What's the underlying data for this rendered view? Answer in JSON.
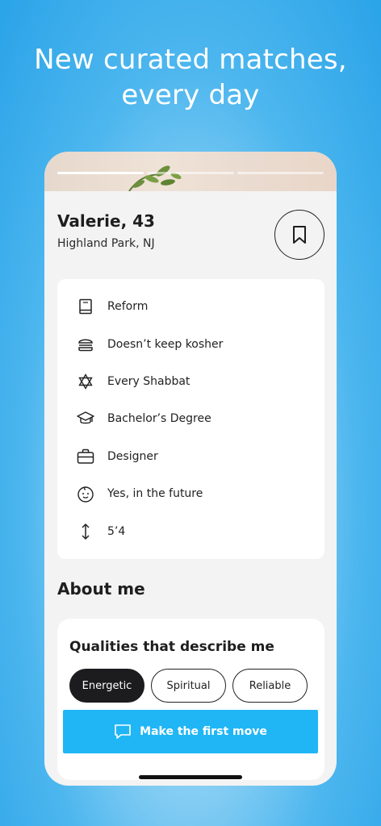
{
  "headline": "New curated matches,\nevery day",
  "headline_lines": [
    "New curated matches,",
    "every day"
  ],
  "profile": {
    "name_age": "Valerie, 43",
    "location": "Highland Park, NJ",
    "photo_count": 3,
    "active_photo": 1
  },
  "details": [
    {
      "icon": "book-icon",
      "label": "Reform"
    },
    {
      "icon": "burger-icon",
      "label": "Doesn’t keep kosher"
    },
    {
      "icon": "star-of-david-icon",
      "label": "Every Shabbat"
    },
    {
      "icon": "graduation-cap-icon",
      "label": "Bachelor’s Degree"
    },
    {
      "icon": "briefcase-icon",
      "label": "Designer"
    },
    {
      "icon": "baby-face-icon",
      "label": "Yes, in the future"
    },
    {
      "icon": "height-arrow-icon",
      "label": "5’4"
    }
  ],
  "about": {
    "heading": "About me",
    "qualities_title": "Qualities that describe me",
    "qualities": [
      {
        "label": "Energetic",
        "selected": true
      },
      {
        "label": "Spiritual",
        "selected": false
      },
      {
        "label": "Reliable",
        "selected": false
      }
    ]
  },
  "cta": {
    "label": "Make the first move",
    "icon": "chat-bubble-icon"
  },
  "colors": {
    "accent": "#20b6f5",
    "background": "#2aa3e8",
    "chip_selected": "#1c1c1e"
  }
}
